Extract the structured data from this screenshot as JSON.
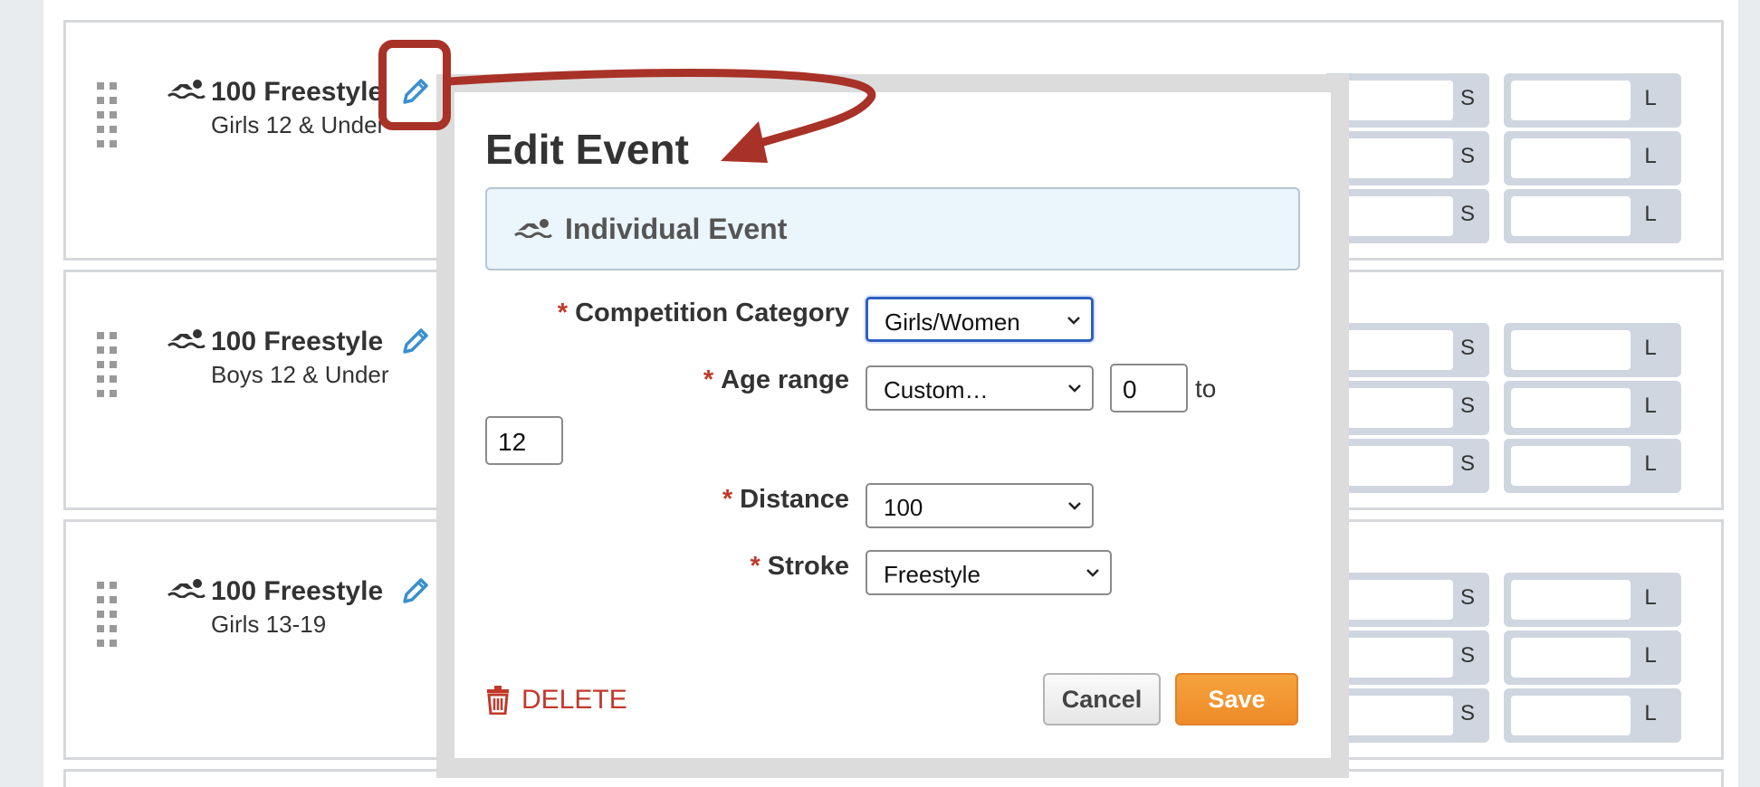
{
  "events": [
    {
      "title": "100 Freestyle",
      "subtitle": "Girls 12 & Under",
      "units": [
        "S",
        "L"
      ]
    },
    {
      "title": "100 Freestyle",
      "subtitle": "Boys 12 & Under",
      "units": [
        "S",
        "L"
      ]
    },
    {
      "title": "100 Freestyle",
      "subtitle": "Girls 13-19",
      "units": [
        "S",
        "L"
      ]
    }
  ],
  "icons": {
    "swimmer": "swimmer-icon",
    "edit": "pencil-icon",
    "drag": "drag-handle-icon",
    "trash": "trash-icon"
  },
  "modal": {
    "title": "Edit Event",
    "event_type": "Individual Event",
    "fields": {
      "competition_category": {
        "label": "Competition Category",
        "value": "Girls/Women"
      },
      "age_range": {
        "label": "Age range",
        "value": "Custom…",
        "min": "0",
        "to": "to",
        "max": "12"
      },
      "distance": {
        "label": "Distance",
        "value": "100"
      },
      "stroke": {
        "label": "Stroke",
        "value": "Freestyle"
      }
    },
    "required_marker": "*",
    "delete_label": "DELETE",
    "cancel_label": "Cancel",
    "save_label": "Save"
  },
  "colors": {
    "accent_red": "#a83227",
    "save_orange": "#f09530",
    "edit_blue": "#3a8fd0",
    "required_red": "#c0392b"
  }
}
